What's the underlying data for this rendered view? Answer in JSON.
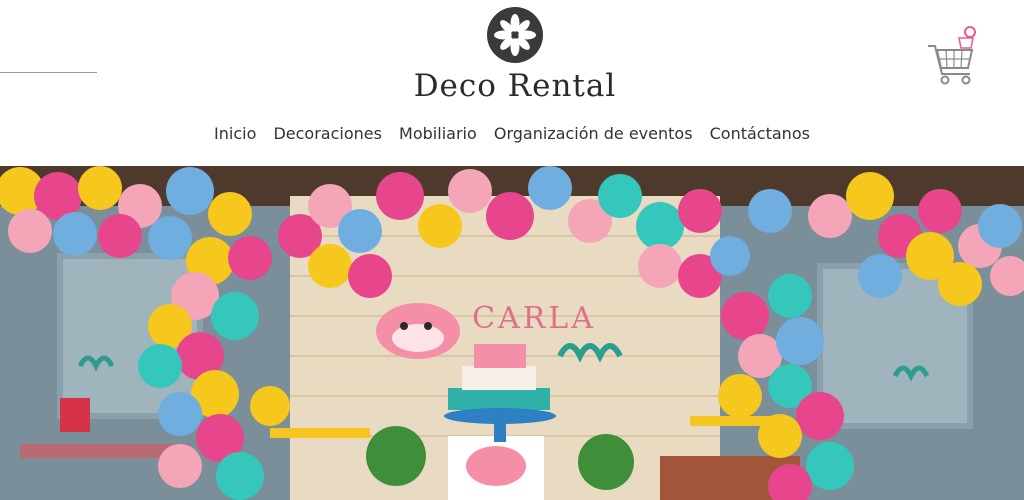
{
  "brand": {
    "name": "Deco Rental"
  },
  "nav": {
    "items": [
      {
        "label": "Inicio"
      },
      {
        "label": "Decoraciones"
      },
      {
        "label": "Mobiliario"
      },
      {
        "label": "Organización de eventos"
      },
      {
        "label": "Contáctanos"
      }
    ]
  },
  "hero": {
    "banner_name": "CARLA"
  },
  "colors": {
    "brand_text": "#2b2b2b",
    "cart_accent": "#e85c8a"
  }
}
